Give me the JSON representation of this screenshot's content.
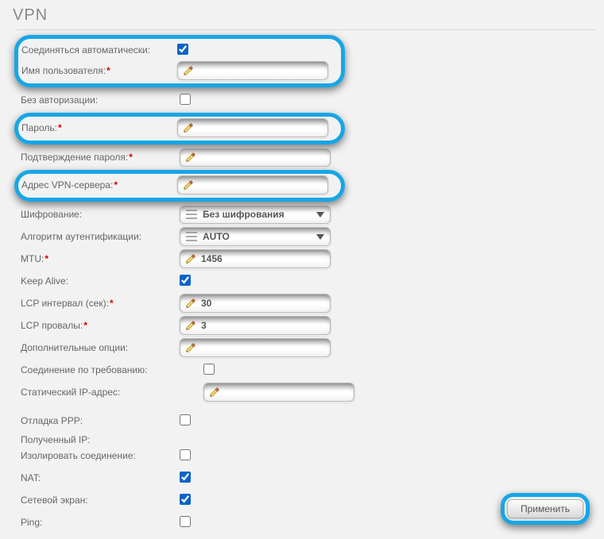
{
  "title": "VPN",
  "rows": {
    "auto_connect": {
      "label": "Соединяться автоматически:",
      "required": false
    },
    "username": {
      "label": "Имя пользователя:",
      "required": true
    },
    "no_auth": {
      "label": "Без авторизации:",
      "required": false
    },
    "password": {
      "label": "Пароль:",
      "required": true
    },
    "password2": {
      "label": "Подтверждение пароля:",
      "required": true
    },
    "server": {
      "label": "Адрес VPN-сервера:",
      "required": true
    },
    "encryption": {
      "label": "Шифрование:",
      "required": false,
      "value": "Без шифрования"
    },
    "auth_algo": {
      "label": "Алгоритм аутентификации:",
      "required": false,
      "value": "AUTO"
    },
    "mtu": {
      "label": "MTU:",
      "required": true,
      "value": "1456"
    },
    "keepalive": {
      "label": "Keep Alive:",
      "required": false
    },
    "lcp_interval": {
      "label": "LCP интервал (сек):",
      "required": true,
      "value": "30"
    },
    "lcp_fails": {
      "label": "LCP провалы:",
      "required": true,
      "value": "3"
    },
    "extra_opts": {
      "label": "Дополнительные опции:",
      "required": false
    },
    "on_demand": {
      "label": "Соединение по требованию:",
      "required": false
    },
    "static_ip": {
      "label": "Статический IP-адрес:",
      "required": false
    },
    "ppp_debug": {
      "label": "Отладка PPP:",
      "required": false
    },
    "received_ip": {
      "label": "Полученный IP:",
      "required": false
    },
    "isolate": {
      "label": "Изолировать соединение:",
      "required": false
    },
    "nat": {
      "label": "NAT:",
      "required": false
    },
    "firewall": {
      "label": "Сетевой экран:",
      "required": false
    },
    "ping": {
      "label": "Ping:",
      "required": false
    }
  },
  "checks": {
    "auto_connect": true,
    "no_auth": false,
    "keepalive": true,
    "on_demand": false,
    "ppp_debug": false,
    "isolate": false,
    "nat": true,
    "firewall": true,
    "ping": false
  },
  "button": {
    "apply": "Применить"
  }
}
